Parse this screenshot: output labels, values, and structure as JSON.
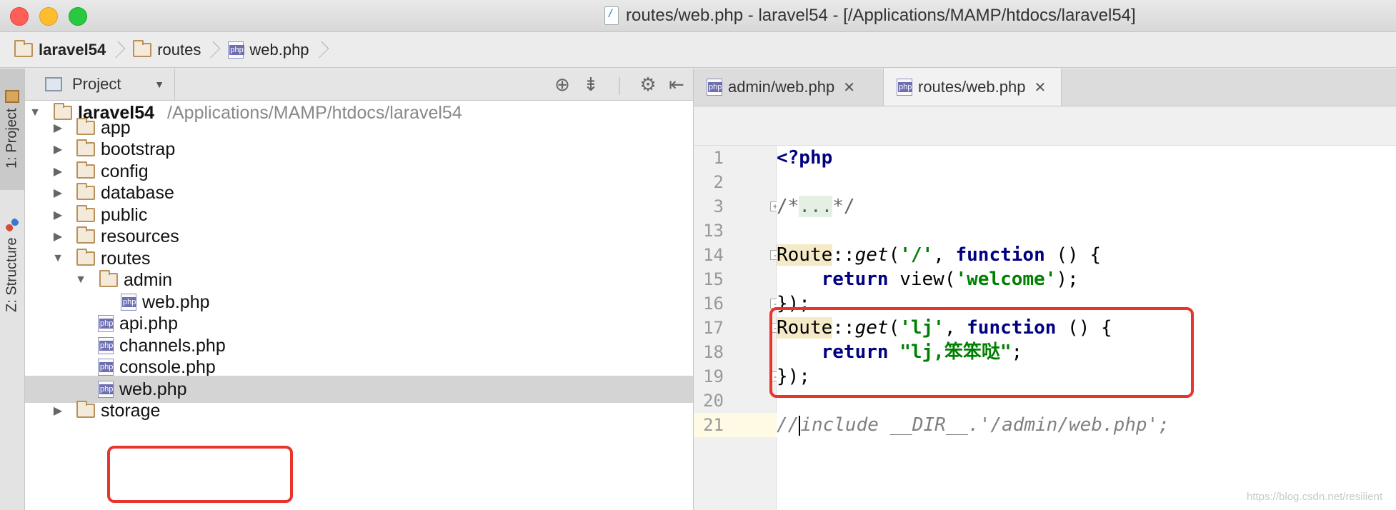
{
  "window": {
    "title": "routes/web.php - laravel54 - [/Applications/MAMP/htdocs/laravel54]"
  },
  "navbar": {
    "crumbs": [
      "laravel54",
      "routes",
      "web.php"
    ]
  },
  "toolstrip": {
    "project_tab": "1: Project",
    "structure_tab": "Z: Structure"
  },
  "project_panel": {
    "selector_label": "Project",
    "root_name": "laravel54",
    "root_path": "/Applications/MAMP/htdocs/laravel54",
    "items": [
      {
        "label": "app",
        "type": "folder",
        "expanded": false
      },
      {
        "label": "bootstrap",
        "type": "folder",
        "expanded": false
      },
      {
        "label": "config",
        "type": "folder",
        "expanded": false
      },
      {
        "label": "database",
        "type": "folder",
        "expanded": false
      },
      {
        "label": "public",
        "type": "folder",
        "expanded": false
      },
      {
        "label": "resources",
        "type": "folder",
        "expanded": false
      },
      {
        "label": "routes",
        "type": "folder",
        "expanded": true
      },
      {
        "label": "admin",
        "type": "folder",
        "expanded": true
      },
      {
        "label": "web.php",
        "type": "php"
      },
      {
        "label": "api.php",
        "type": "php"
      },
      {
        "label": "channels.php",
        "type": "php"
      },
      {
        "label": "console.php",
        "type": "php"
      },
      {
        "label": "web.php",
        "type": "php",
        "selected": true
      },
      {
        "label": "storage",
        "type": "folder",
        "expanded": false
      }
    ]
  },
  "editor": {
    "tabs": [
      {
        "label": "admin/web.php",
        "active": false
      },
      {
        "label": "routes/web.php",
        "active": true
      }
    ],
    "line_numbers": [
      "1",
      "2",
      "3",
      "13",
      "14",
      "15",
      "16",
      "17",
      "18",
      "19",
      "20",
      "21"
    ],
    "code": {
      "l1": "<?php",
      "l3_open": "/*",
      "l3_dots": "...",
      "l3_close": "*/",
      "route": "Route",
      "sep": "::",
      "get": "get",
      "paren_open": "(",
      "l14_arg": "'/'",
      "comma": ", ",
      "function_kw": "function",
      "fn_tail": " () {",
      "return_kw": "return",
      "l15_mid": " view(",
      "l15_str": "'welcome'",
      "l15_end": ");",
      "close": "});",
      "l17_arg": "'lj'",
      "l18_str": "\"lj,笨笨哒\"",
      "semicolon": ";",
      "l21_slashes": "//",
      "l21_rest": "include __DIR__.'/admin/web.php';"
    }
  },
  "watermark": "https://blog.csdn.net/resilient",
  "colors": {
    "annotation": "#e8352c",
    "keyword": "#000080",
    "string": "#008000"
  }
}
